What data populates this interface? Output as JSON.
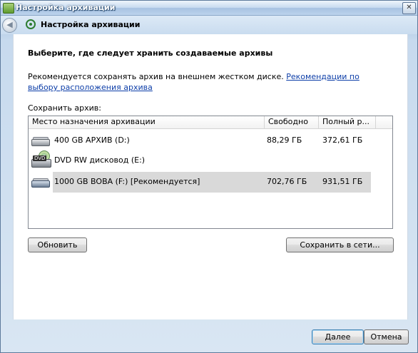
{
  "window": {
    "title": "Настройка архивации",
    "close_glyph": "✕"
  },
  "nav": {
    "back_glyph": "◀",
    "title": "Настройка архивации"
  },
  "content": {
    "heading": "Выберите, где следует хранить создаваемые архивы",
    "recommend_text": "Рекомендуется сохранять архив на внешнем жестком диске.",
    "recommend_link": "Рекомендации по выбору расположения архива",
    "save_label": "Сохранить архив:"
  },
  "list": {
    "columns": [
      "Место назначения архивации",
      "Свободно",
      "Полный р..."
    ],
    "rows": [
      {
        "name": "400 GB АРХИВ (D:)",
        "free": "88,29 ГБ",
        "total": "372,61 ГБ",
        "icon": "hard-drive-icon"
      },
      {
        "name": "DVD RW дисковод (E:)",
        "free": "",
        "total": "",
        "icon": "dvd-drive-icon",
        "badge": "DVD"
      },
      {
        "name": "1000 GB BOBA (F:) [Рекомендуется]",
        "free": "702,76 ГБ",
        "total": "931,51 ГБ",
        "icon": "external-drive-icon"
      }
    ]
  },
  "buttons": {
    "refresh": "Обновить",
    "save_network": "Сохранить в сети...",
    "next": "Далее",
    "cancel": "Отмена"
  }
}
